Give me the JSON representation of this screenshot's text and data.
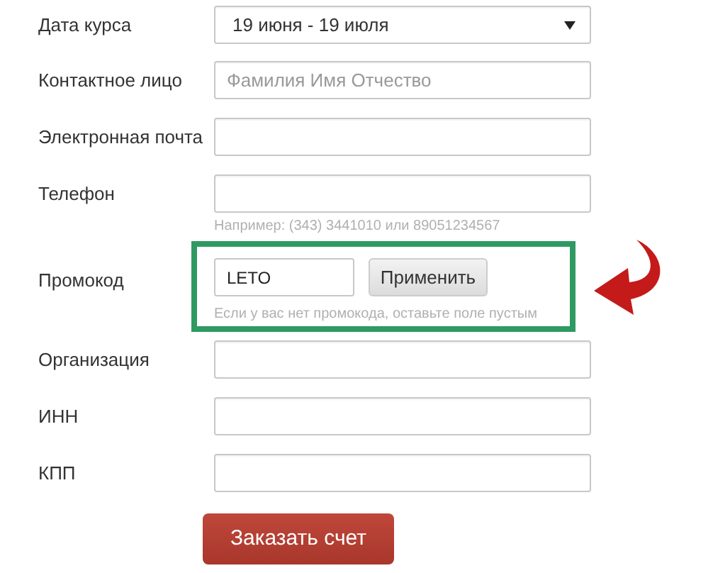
{
  "fields": [
    {
      "kind": "select",
      "label": "Дата курса",
      "value": "19 июня - 19 июля"
    },
    {
      "kind": "text",
      "label": "Контактное лицо",
      "placeholder": "Фамилия Имя Отчество"
    },
    {
      "kind": "text",
      "label": "Электронная почта"
    },
    {
      "kind": "text",
      "label": "Телефон",
      "hint": "Например: (343) 3441010 или 89051234567"
    },
    {
      "kind": "promo",
      "label": "Промокод",
      "value": "LETO",
      "button": "Применить",
      "hint": "Если у вас нет промокода, оставьте поле пустым"
    },
    {
      "kind": "text",
      "label": "Организация"
    },
    {
      "kind": "text",
      "label": "ИНН"
    },
    {
      "kind": "text",
      "label": "КПП"
    }
  ],
  "submit": "Заказать счет"
}
